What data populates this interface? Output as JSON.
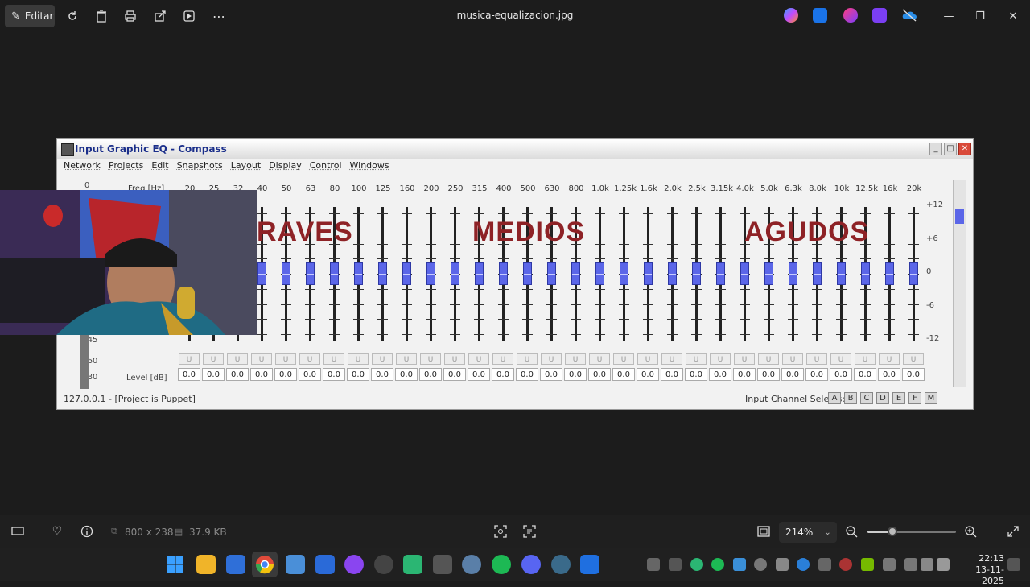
{
  "topbar": {
    "edit_label": "Editar",
    "file_title": "musica-equalizacion.jpg"
  },
  "eq_window": {
    "title": "Input Graphic EQ - Compass",
    "menu": [
      "Network",
      "Projects",
      "Edit",
      "Snapshots",
      "Layout",
      "Display",
      "Control",
      "Windows"
    ],
    "freq_header": "Freq [Hz]",
    "freqs": [
      "20",
      "25",
      "32",
      "40",
      "50",
      "63",
      "80",
      "100",
      "125",
      "160",
      "200",
      "250",
      "315",
      "400",
      "500",
      "630",
      "800",
      "1.0k",
      "1.25k",
      "1.6k",
      "2.0k",
      "2.5k",
      "3.15k",
      "4.0k",
      "5.0k",
      "6.3k",
      "8.0k",
      "10k",
      "12.5k",
      "16k",
      "20k"
    ],
    "db_scale": [
      "+12",
      "+6",
      "0",
      "-6",
      "-12"
    ],
    "left_scale": [
      "0",
      "-45",
      "-60",
      "-80"
    ],
    "level_header": "Level [dB]",
    "levels": [
      "0.0",
      "0.0",
      "0.0",
      "0.0",
      "0.0",
      "0.0",
      "0.0",
      "0.0",
      "0.0",
      "0.0",
      "0.0",
      "0.0",
      "0.0",
      "0.0",
      "0.0",
      "0.0",
      "0.0",
      "0.0",
      "0.0",
      "0.0",
      "0.0",
      "0.0",
      "0.0",
      "0.0",
      "0.0",
      "0.0",
      "0.0",
      "0.0",
      "0.0",
      "0.0",
      "0.0"
    ],
    "gain_values_db": [
      0,
      0,
      0,
      0,
      0,
      0,
      0,
      0,
      0,
      0,
      0,
      0,
      0,
      0,
      0,
      0,
      0,
      0,
      0,
      0,
      0,
      0,
      0,
      0,
      0,
      0,
      0,
      0,
      0,
      0,
      0
    ],
    "u_label": "U",
    "overlay_labels": [
      "RAVES",
      "MEDIOS",
      "AGUDOS"
    ],
    "status_left": "127.0.0.1 - [Project is Puppet]",
    "status_right": "Input Channel Selects:",
    "channels": [
      "A",
      "B",
      "C",
      "D",
      "E",
      "F",
      "M"
    ]
  },
  "bottombar": {
    "dimensions": "800 x 238",
    "file_size": "37.9 KB",
    "zoom_value": "214%",
    "zoom_fraction": 0.28
  },
  "taskbar": {
    "time": "22:13",
    "date": "13-11-2025"
  },
  "colors": {
    "knob": "#5b66e8",
    "overlay_text": "#8e2226",
    "title_text": "#1a2e8a"
  }
}
